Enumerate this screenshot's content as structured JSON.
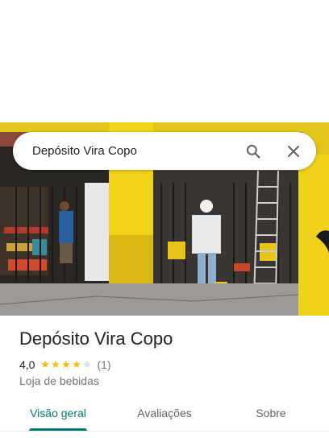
{
  "search": {
    "query": "Depósito Vira Copo",
    "search_icon": "search-icon",
    "close_icon": "close-icon"
  },
  "place": {
    "name": "Depósito Vira Copo",
    "rating": "4,0",
    "rating_stars": 4,
    "review_count": "(1)",
    "category": "Loja de bebidas"
  },
  "tabs": [
    {
      "label": "Visão geral",
      "active": true
    },
    {
      "label": "Avaliações",
      "active": false
    },
    {
      "label": "Sobre",
      "active": false
    }
  ],
  "colors": {
    "accent": "#00796b",
    "star": "#fbbc04",
    "wall_yellow": "#f2d31c"
  }
}
